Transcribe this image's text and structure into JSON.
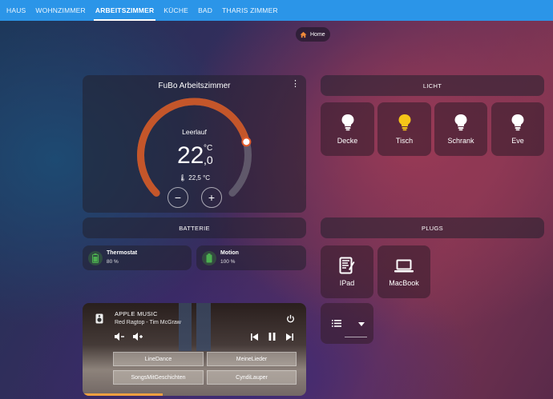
{
  "nav": {
    "tabs": [
      {
        "label": "HAUS"
      },
      {
        "label": "WOHNZIMMER"
      },
      {
        "label": "ARBEITSZIMMER"
      },
      {
        "label": "KÜCHE"
      },
      {
        "label": "BAD"
      },
      {
        "label": "THARIS ZIMMER"
      }
    ],
    "active_index": 2
  },
  "breadcrumb": {
    "label": "Home"
  },
  "thermostat": {
    "title": "FuBo Arbeitszimmer",
    "state": "Leerlauf",
    "target_int": "22",
    "target_dec": ",0",
    "unit": "°C",
    "current": "22,5 °C",
    "minus_label": "−",
    "plus_label": "+",
    "slider_level": 0.78
  },
  "licht": {
    "header": "LICHT",
    "tiles": [
      {
        "label": "Decke",
        "on": false
      },
      {
        "label": "Tisch",
        "on": true
      },
      {
        "label": "Schrank",
        "on": false
      },
      {
        "label": "Eve",
        "on": false
      }
    ]
  },
  "batterie": {
    "header": "BATTERIE",
    "items": [
      {
        "name": "Thermostat",
        "value": "80 %"
      },
      {
        "name": "Motion",
        "value": "100 %"
      }
    ]
  },
  "plugs": {
    "header": "PLUGS",
    "tiles": [
      {
        "label": "IPad",
        "icon": "ipad-icon"
      },
      {
        "label": "MacBook",
        "icon": "laptop-icon"
      }
    ]
  },
  "media": {
    "title": "APPLE MUSIC",
    "subtitle": "Red Ragtop - Tim McGraw",
    "playlists": [
      "LineDance",
      "MeineLieder",
      "SongsMitGeschichten",
      "CyndiLauper"
    ],
    "progress": 0.36
  },
  "colors": {
    "topbar": "#2b95e8",
    "thermo_arc": "#c4562a",
    "bulb_on": "#f5c518",
    "battery": "#4caf50"
  }
}
